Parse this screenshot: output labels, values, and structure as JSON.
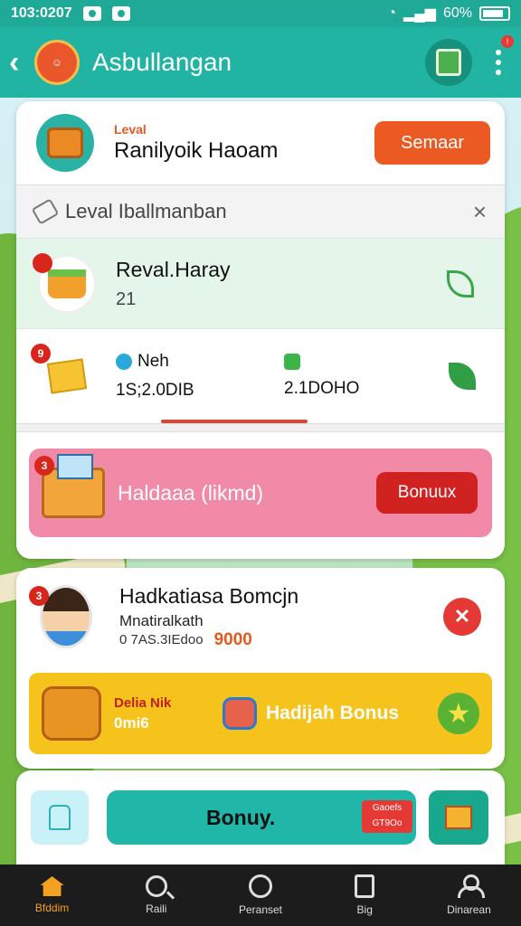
{
  "status_bar": {
    "time": "103:0207",
    "battery": "60%"
  },
  "app_bar": {
    "title": "Asbullangan",
    "logo_text": ""
  },
  "level_card": {
    "small_label": "Leval",
    "title": "Ranilyoik Haoam",
    "button": "Semaar"
  },
  "filter": {
    "label": "Leval Iballmanban",
    "close": "×"
  },
  "reward": {
    "title": "Reval.Haray",
    "value": "21",
    "badge": ""
  },
  "stats": {
    "badge": "9",
    "left_label": "Neh",
    "left_value": "1S;2.0DIB",
    "right_label": "",
    "right_value": "2.1DOHO"
  },
  "promo": {
    "badge": "3",
    "title": "Haldaaa (likmd)",
    "button": "Bonuux"
  },
  "user": {
    "badge": "3",
    "name": "Hadkatiasa Bomcjn",
    "subtitle": "Mnatiralkath",
    "meta": "0 7AS.3IEdoo",
    "coins": "9000"
  },
  "bonus_banner": {
    "small": "Delia Nik",
    "sub": "0mi6",
    "title": "Hadijah Bonus"
  },
  "bottom_action": {
    "button": "Bonuy.",
    "sale_line1": "Gaoefs",
    "sale_line2": "GT9Oo"
  },
  "bottom_nav": [
    {
      "label": "Bfddim"
    },
    {
      "label": "Raili"
    },
    {
      "label": "Peranset"
    },
    {
      "label": "Big"
    },
    {
      "label": "Dinarean"
    }
  ],
  "colors": {
    "header_teal": "#22b4a2",
    "accent_orange": "#ea5a22",
    "promo_pink": "#f08aa6",
    "banner_yellow": "#f6c21c",
    "nav_active": "#f3a21f"
  },
  "icons": [
    "back-icon",
    "app-logo",
    "document-icon",
    "more-icon",
    "chest-icon",
    "tag-icon",
    "close-icon",
    "basket-icon",
    "leaf-icon",
    "box-icon",
    "arrow-leaf-icon",
    "gift-icon",
    "star-icon",
    "home-icon",
    "search-icon",
    "doc-icon",
    "person-icon"
  ]
}
